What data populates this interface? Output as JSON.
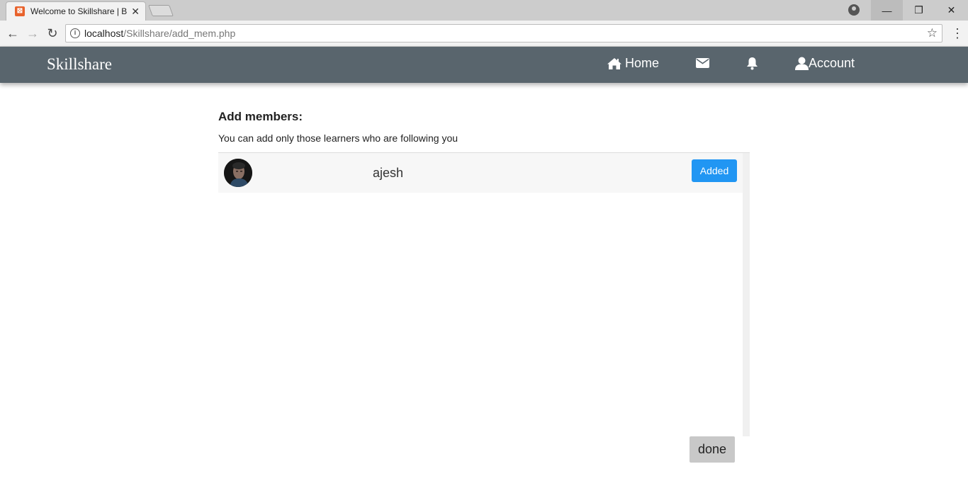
{
  "browser": {
    "tab_title": "Welcome to Skillshare | B",
    "favicon_letter": "✕",
    "url_host": "localhost",
    "url_path": "/Skillshare/add_mem.php"
  },
  "navbar": {
    "brand": "Skillshare",
    "home_label": "Home",
    "account_label": "Account",
    "background_color": "#59656d"
  },
  "page": {
    "heading": "Add members:",
    "subtext": "You can add only those learners who are following you",
    "members": [
      {
        "name": "ajesh",
        "status_label": "Added"
      }
    ],
    "done_label": "done",
    "accent_color": "#2196f3"
  }
}
